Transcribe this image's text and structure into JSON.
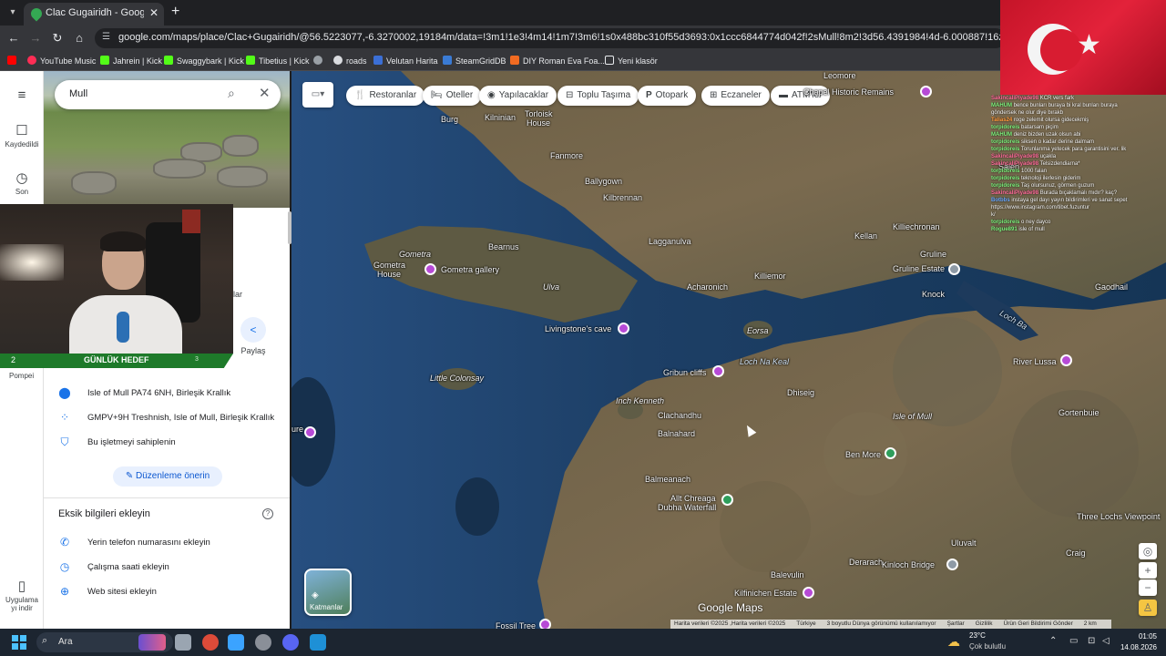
{
  "browser": {
    "tab_title": "Clac Gugairidh - Google Haritalar",
    "url": "google.com/maps/place/Clac+Gugairidh/@56.5223077,-6.3270002,19184m/data=!3m1!1e3!4m14!1m7!3m6!1s0x488bc310f55d3693:0x1ccc6844774d042f!2sMull!8m2!3d56.4391984!4d-6.000887!16zL20vMDl0X2xf!3m5!1s0x488b917ff2f",
    "bookmarks": [
      "YouTube Music",
      "Jahrein | Kick",
      "Swaggybark | Kick",
      "Tibetius | Kick",
      "roads",
      "Velutan Harita",
      "SteamGridDB",
      "DIY Roman Eva Foa...",
      "Yeni klasör"
    ]
  },
  "rail": {
    "menu_icon": "menu-icon",
    "saved_label": "Kaydedildi",
    "recent_label": "Son",
    "app_label_1": "Uygulama",
    "app_label_2": "yı indir"
  },
  "search": {
    "value": "Mull"
  },
  "panel": {
    "share_label": "Paylaş",
    "partial_text": "lar",
    "pompei": "Pompei",
    "address": "Isle of Mull PA74 6NH, Birleşik Krallık",
    "plus_code": "GMPV+9H Treshnish, Isle of Mull, Birleşik Krallık",
    "claim": "Bu işletmeyi sahiplenin",
    "suggest_edit": "Düzenleme önerin",
    "missing_info_title": "Eksik bilgileri ekleyin",
    "add_phone": "Yerin telefon numarasını ekleyin",
    "add_hours": "Çalışma saati ekleyin",
    "add_website": "Web sitesi ekleyin"
  },
  "goal": {
    "number": "2",
    "label": "GÜNLÜK HEDEF",
    "count": "3"
  },
  "chips": [
    {
      "label": "Restoranlar",
      "icon": "fork-knife-icon"
    },
    {
      "label": "Oteller",
      "icon": "bed-icon"
    },
    {
      "label": "Yapılacaklar",
      "icon": "camera-icon"
    },
    {
      "label": "Toplu Taşıma",
      "icon": "train-icon"
    },
    {
      "label": "Otopark",
      "icon": "parking-icon"
    },
    {
      "label": "Eczaneler",
      "icon": "pharmacy-icon"
    },
    {
      "label": "ATM'ler",
      "icon": "atm-icon"
    }
  ],
  "map_labels": {
    "leomore": "Leomore",
    "chapel": "Chapel Historic Remains",
    "burg": "Burg",
    "kilninian": "Kilninian",
    "torloisk_1": "Torloisk",
    "torloisk_2": "House",
    "fanmore": "Fanmore",
    "ballygown": "Ballygown",
    "kilbrennan": "Kilbrennan",
    "salen": "Salen",
    "killiechronan": "Killiechronan",
    "kellan": "Kellan",
    "gruline": "Gruline",
    "gruline_estate": "Gruline Estate",
    "knock": "Knock",
    "gaodhail": "Gaodhail",
    "loch_ba": "Loch Ba",
    "gometra": "Gometra",
    "gometra_house_1": "Gometra",
    "gometra_house_2": "House",
    "gometra_gallery": "Gometra gallery",
    "bearnus": "Bearnus",
    "lagganulva": "Lagganulva",
    "killiemor": "Killiemor",
    "acharonich": "Acharonich",
    "ulva": "Ulva",
    "livingstones_cave": "Livingstone's cave",
    "eorsa": "Eorsa",
    "loch_na_keal": "Loch Na Keal",
    "gribun_cliffs": "Gribun cliffs",
    "dhiseig": "Dhiseig",
    "river_lussa": "River Lussa",
    "little_colonsay": "Little Colonsay",
    "inch_kenneth": "Inch Kenneth",
    "clachandhu": "Clachandhu",
    "balnahard": "Balnahard",
    "isle_of_mull": "Isle of Mull",
    "gortenbuie": "Gortenbuie",
    "ben_more": "Ben More",
    "ure": "ure",
    "balmeanach": "Balmeanach",
    "allt_chreaga_1": "Allt Chreaga",
    "allt_chreaga_2": "Dubha Waterfall",
    "three_lochs": "Three Lochs Viewpoint",
    "uluvalt": "Uluvalt",
    "craig": "Craig",
    "derarach": "Derarach",
    "kinloch_bridge": "Kinloch Bridge",
    "balevulin": "Balevulin",
    "kilfinichen": "Kilfinichen Estate",
    "fossil_tree": "Fossil Tree"
  },
  "map_ui": {
    "layers_label": "Katmanlar",
    "logo": "Google Maps",
    "attribution": [
      "Harita verileri ©2025 ,Harita verileri ©2025",
      "Türkiye",
      "3 boyutlu Dünya görünümü kullanılamıyor",
      "Şartlar",
      "Gizlilik",
      "Ürün Geri Bildirimi Gönder",
      "2 km"
    ]
  },
  "chat": [
    {
      "user": "SakincaliPiyade98",
      "color": "#ff6b9a",
      "msg": "KCR vers fark"
    },
    {
      "user": "MAHUM",
      "color": "#7cf27c",
      "msg": "bence bunları buraya bi kral bunları buraya"
    },
    {
      "user": "",
      "color": "#ffffff",
      "msg": "göndersek ne olur diye bırakb"
    },
    {
      "user": "Talias24",
      "color": "#ff9a3c",
      "msg": "roge zelemit olursa gidecekmiş"
    },
    {
      "user": "torpidoreis",
      "color": "#7cf27c",
      "msg": "batarsam piçim"
    },
    {
      "user": "MAHUM",
      "color": "#7cf27c",
      "msg": "deniz bizden uzak olsun abi"
    },
    {
      "user": "torpidoreis",
      "color": "#7cf27c",
      "msg": "siksen o kadar derine dalmam"
    },
    {
      "user": "torpidoreis",
      "color": "#7cf27c",
      "msg": "Torunlarıma yetecek para garantisini ver. lik"
    },
    {
      "user": "SakincaliPiyade98",
      "color": "#ff6b9a",
      "msg": "uçakla"
    },
    {
      "user": "SakincaliPiyade98",
      "color": "#ff6b9a",
      "msg": "Telsizdendiarna*"
    },
    {
      "user": "torpidoreis",
      "color": "#7cf27c",
      "msg": "1000 falan"
    },
    {
      "user": "torpidoreis",
      "color": "#7cf27c",
      "msg": "teknoloji ilerlesin giderim"
    },
    {
      "user": "torpidoreis",
      "color": "#7cf27c",
      "msg": "Taş olursunuz, görmen guzum"
    },
    {
      "user": "SakincaliPiyade98",
      "color": "#ff6b9a",
      "msg": "Burada bıçaklamalı mıdır? kaç?"
    },
    {
      "user": "Botbbs",
      "color": "#6aa9ff",
      "msg": "instaya gel dayı yayın bildirimleri ve sanat sepet"
    },
    {
      "user": "",
      "color": "#ffffff",
      "msg": "https://www.instagram.com/tibet.fuzuntur"
    },
    {
      "user": "",
      "color": "#ffffff",
      "msg": "k/"
    },
    {
      "user": "torpidoreis",
      "color": "#7cf27c",
      "msg": "o ney dayco"
    },
    {
      "user": "Rogue891",
      "color": "#7cf27c",
      "msg": "isle of mull"
    }
  ],
  "taskbar": {
    "search": "Ara",
    "temp": "23°C",
    "condition": "Çok bulutlu",
    "time": "01:05",
    "date": "14.08.2026"
  }
}
